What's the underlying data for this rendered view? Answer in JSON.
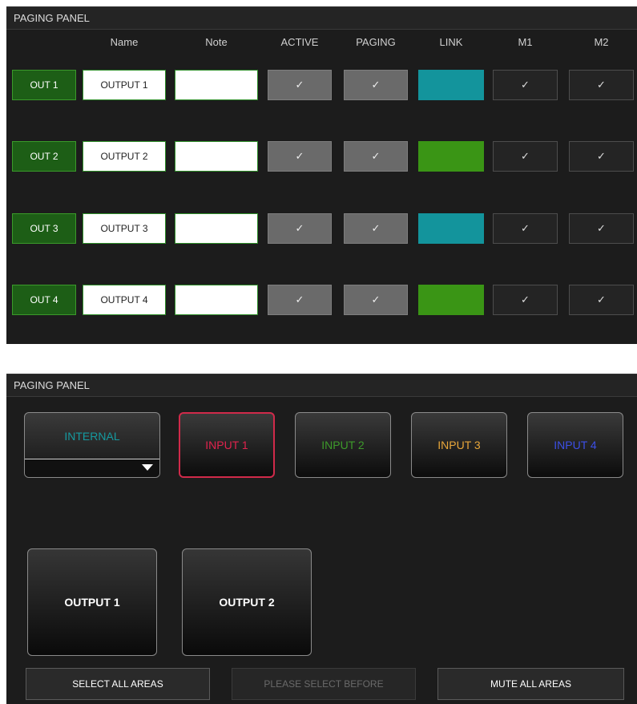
{
  "panel1": {
    "title": "PAGING PANEL",
    "columns": {
      "name": "Name",
      "note": "Note",
      "active": "ACTIVE",
      "paging": "PAGING",
      "link": "LINK",
      "m1": "M1",
      "m2": "M2"
    },
    "check": "✓",
    "rows": [
      {
        "out": "OUT 1",
        "name": "OUTPUT 1",
        "note": "",
        "link_color": "#13949c"
      },
      {
        "out": "OUT 2",
        "name": "OUTPUT 2",
        "note": "",
        "link_color": "#3a9515"
      },
      {
        "out": "OUT 3",
        "name": "OUTPUT 3",
        "note": "",
        "link_color": "#13949c"
      },
      {
        "out": "OUT 4",
        "name": "OUTPUT 4",
        "note": "",
        "link_color": "#3a9515"
      }
    ]
  },
  "panel2": {
    "title": "PAGING PANEL",
    "sources": [
      {
        "label": "INTERNAL",
        "color": "#159aa0",
        "dropdown": true
      },
      {
        "label": "INPUT 1",
        "color": "#e0234d",
        "selected": true
      },
      {
        "label": "INPUT 2",
        "color": "#3d9a2a"
      },
      {
        "label": "INPUT 3",
        "color": "#e8a63a"
      },
      {
        "label": "INPUT 4",
        "color": "#3c4fe6"
      }
    ],
    "outputs": [
      "OUTPUT 1",
      "OUTPUT 2"
    ],
    "actions": {
      "select_all": "SELECT ALL AREAS",
      "please_select": "PLEASE SELECT BEFORE",
      "mute_all": "MUTE ALL AREAS"
    }
  }
}
